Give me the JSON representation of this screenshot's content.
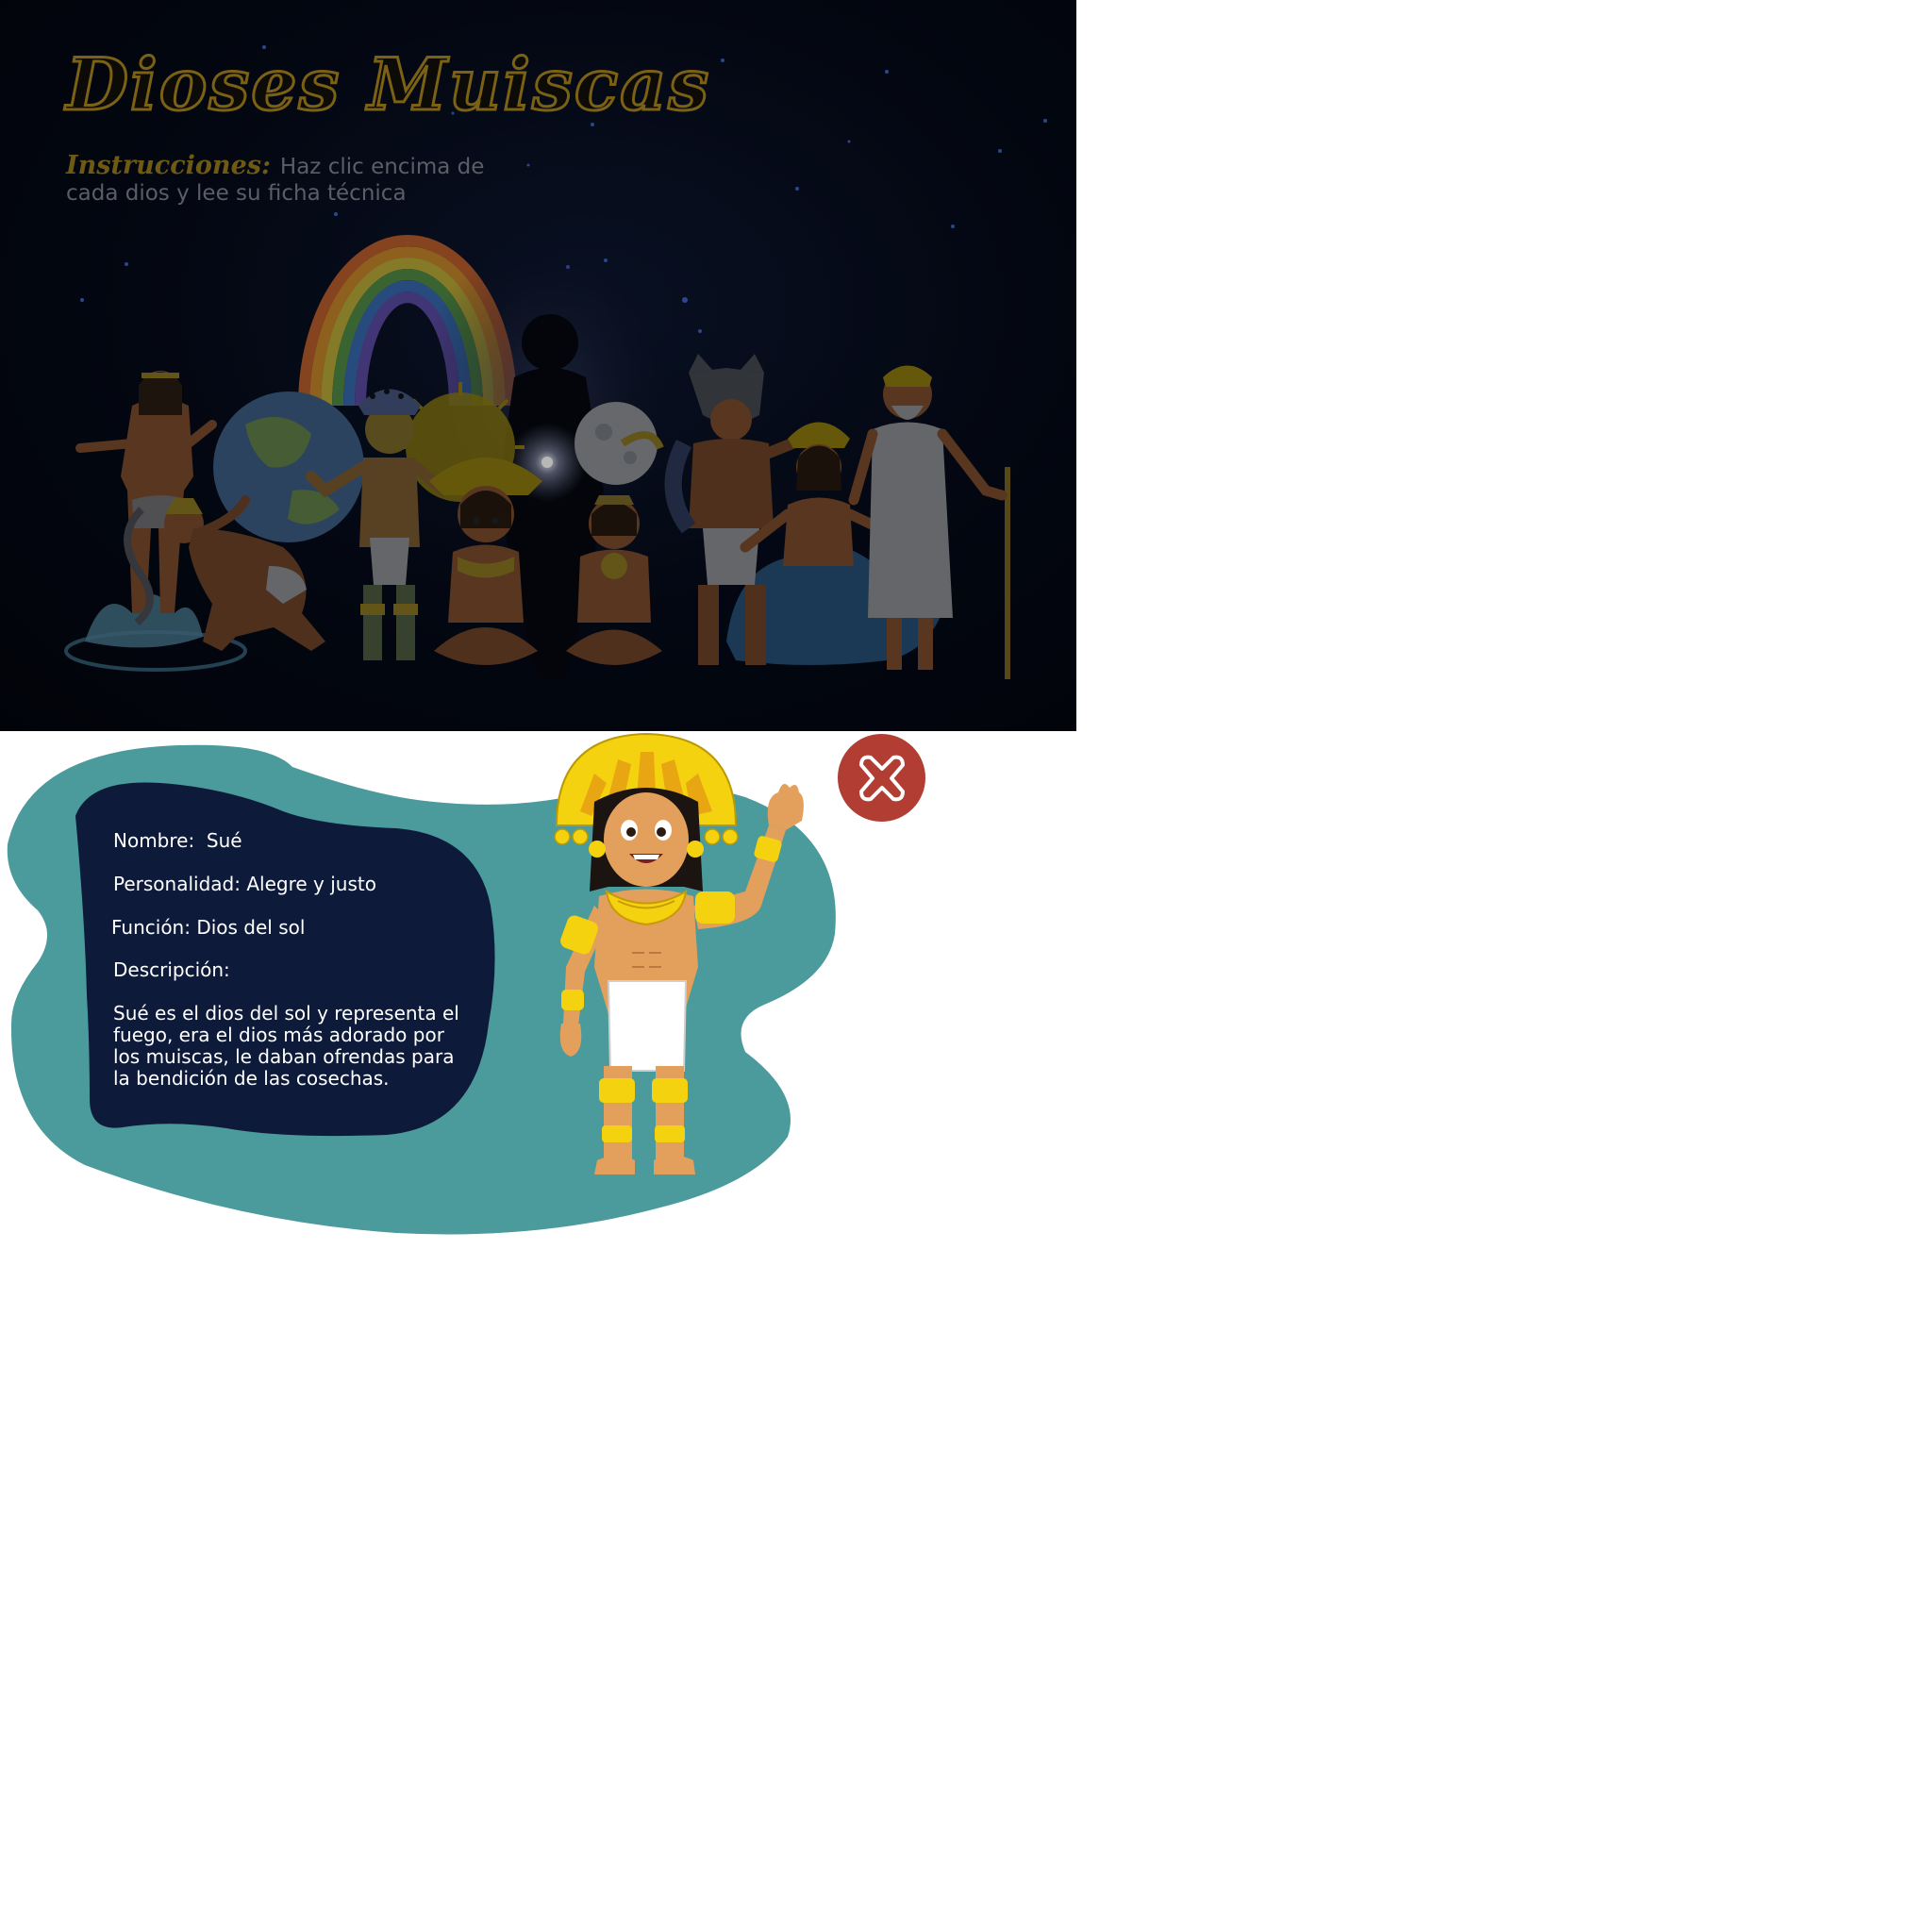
{
  "scene": {
    "title": "Dioses Muiscas",
    "instructions_label": "Instrucciones:",
    "instructions_text": "Haz clic encima de cada dios y lee su ficha técnica",
    "gods": [
      "goddess-water",
      "god-earth-carrier",
      "god-rainbow",
      "god-sun-seated",
      "god-shadow",
      "god-moon-seated",
      "god-jaguar",
      "goddess-sea",
      "god-old-staff"
    ]
  },
  "modal": {
    "name_label": "Nombre:",
    "name_value": "Sué",
    "personality_label": "Personalidad:",
    "personality_value": "Alegre y justo",
    "function_label": "Función:",
    "function_value": "Dios del sol",
    "description_label": "Descripción:",
    "description": "Sué es el dios del sol y representa el fuego, era el dios más adorado por los muiscas, le daban ofrendas para la bendición de las cosechas.",
    "close_icon": "close-icon",
    "colors": {
      "blob": "#4b9a9c",
      "card": "#0d1a3a",
      "close": "#b13d33",
      "gold": "#f4d20f"
    }
  }
}
